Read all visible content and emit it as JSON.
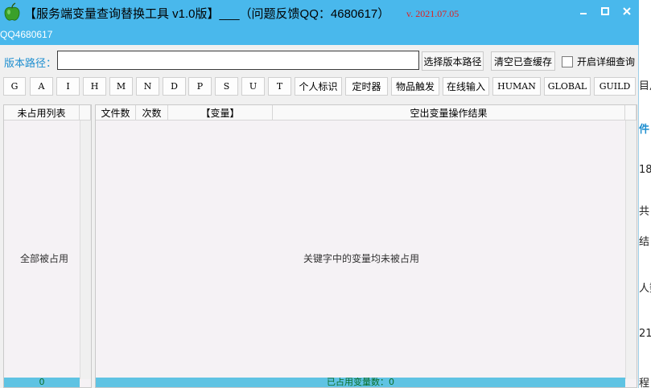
{
  "window": {
    "title": "【服务端变量查询替换工具 v1.0版】___（问题反馈QQ：4680617）",
    "date": "v. 2021.07.05",
    "subtitle": "QQ4680617"
  },
  "path": {
    "label": "版本路径：",
    "value": "",
    "select_button": "选择版本路径",
    "clear_button": "清空已查缓存",
    "detail_checkbox_label": "开启详细查询",
    "detail_checked": false
  },
  "keys": [
    "G",
    "A",
    "I",
    "H",
    "M",
    "N",
    "D",
    "P",
    "S",
    "U",
    "T",
    "个人标识",
    "定时器",
    "物品触发",
    "在线输入",
    "HUMAN",
    "GLOBAL",
    "GUILD"
  ],
  "left_panel": {
    "header": "未占用列表",
    "message": "全部被占用",
    "status": "0"
  },
  "main_panel": {
    "columns": [
      "文件数",
      "次数",
      "【变量】",
      "空出变量操作结果"
    ],
    "message": "关键字中的变量均未被占用",
    "status": "已占用变量数：0"
  },
  "background": {
    "fragments": [
      "目片",
      "件",
      "18",
      "共",
      "结",
      "人数",
      "21",
      "程"
    ]
  },
  "colors": {
    "titlebar": "#49b8ec",
    "accent": "#1f8fd0",
    "date": "#e02020",
    "status_bar": "#5fc3e3"
  }
}
